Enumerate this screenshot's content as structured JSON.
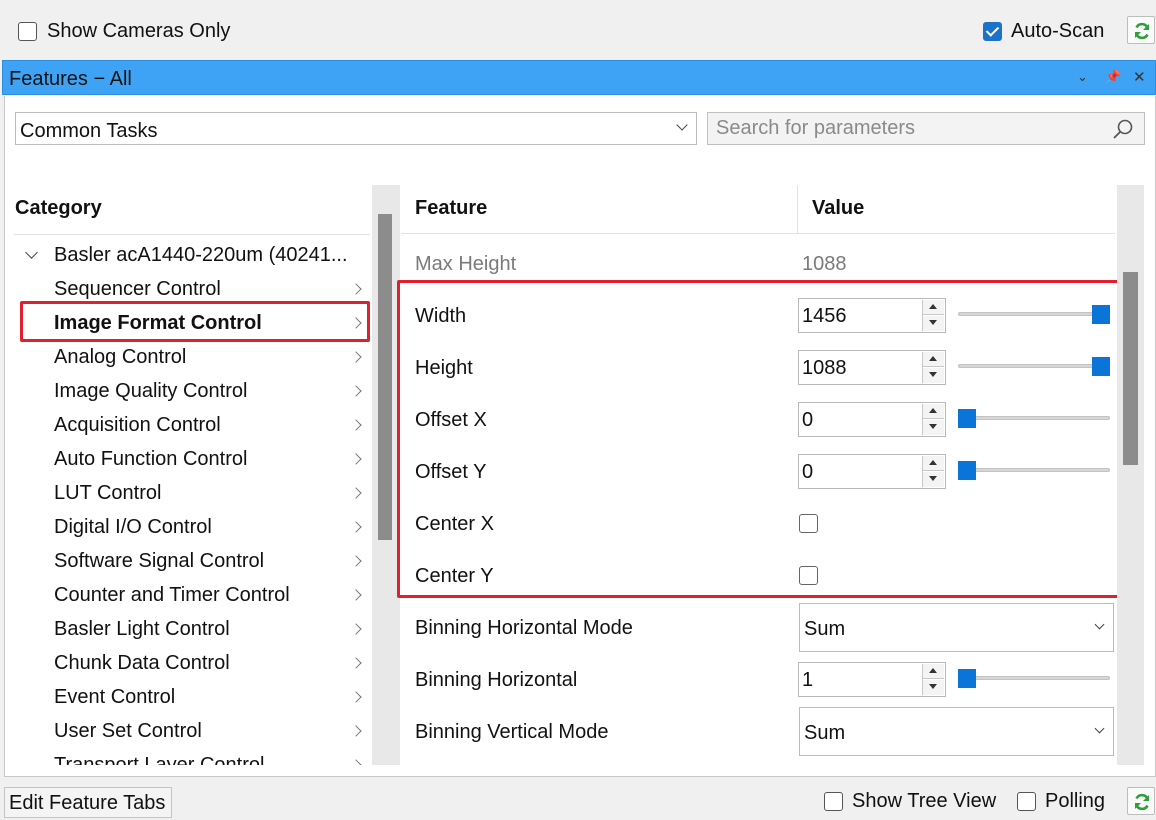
{
  "top_bar": {
    "show_cameras_only": {
      "label": "Show Cameras Only",
      "checked": false
    },
    "auto_scan": {
      "label": "Auto-Scan",
      "checked": true
    }
  },
  "panel": {
    "title": "Features − All",
    "title_icons": [
      "chevron-down-icon",
      "pin-icon",
      "close-icon"
    ]
  },
  "toolbar": {
    "view_select": "Common Tasks",
    "search_placeholder": "Search for parameters"
  },
  "category": {
    "header": "Category",
    "device": "Basler acA1440-220um (40241...",
    "items": [
      {
        "label": "Sequencer Control",
        "selected": false
      },
      {
        "label": "Image Format Control",
        "selected": true
      },
      {
        "label": "Analog Control",
        "selected": false
      },
      {
        "label": "Image Quality Control",
        "selected": false
      },
      {
        "label": "Acquisition Control",
        "selected": false
      },
      {
        "label": "Auto Function Control",
        "selected": false
      },
      {
        "label": "LUT Control",
        "selected": false
      },
      {
        "label": "Digital I/O Control",
        "selected": false
      },
      {
        "label": "Software Signal Control",
        "selected": false
      },
      {
        "label": "Counter and Timer Control",
        "selected": false
      },
      {
        "label": "Basler Light Control",
        "selected": false
      },
      {
        "label": "Chunk Data Control",
        "selected": false
      },
      {
        "label": "Event Control",
        "selected": false
      },
      {
        "label": "User Set Control",
        "selected": false
      },
      {
        "label": "Transport Layer Control",
        "selected": false
      }
    ]
  },
  "features": {
    "header_feature": "Feature",
    "header_value": "Value",
    "rows": [
      {
        "name": "Max Height",
        "type": "readonly",
        "value": "1088"
      },
      {
        "name": "Width",
        "type": "spin",
        "value": "1456",
        "slider_level": 1.0
      },
      {
        "name": "Height",
        "type": "spin",
        "value": "1088",
        "slider_level": 1.0
      },
      {
        "name": "Offset X",
        "type": "spin",
        "value": "0",
        "slider_level": 0.0
      },
      {
        "name": "Offset Y",
        "type": "spin",
        "value": "0",
        "slider_level": 0.0
      },
      {
        "name": "Center X",
        "type": "checkbox",
        "checked": false
      },
      {
        "name": "Center Y",
        "type": "checkbox",
        "checked": false
      },
      {
        "name": "Binning Horizontal Mode",
        "type": "combo",
        "value": "Sum"
      },
      {
        "name": "Binning Horizontal",
        "type": "spin",
        "value": "1",
        "slider_level": 0.0
      },
      {
        "name": "Binning Vertical Mode",
        "type": "combo",
        "value": "Sum"
      }
    ]
  },
  "bottom_bar": {
    "edit_tabs_label": "Edit Feature Tabs",
    "show_tree_view": {
      "label": "Show Tree View",
      "checked": false
    },
    "polling": {
      "label": "Polling",
      "checked": false
    }
  },
  "colors": {
    "title_bar": "#3fa3f5",
    "highlight_box": "#e0202e",
    "slider_thumb": "#0a74d8",
    "refresh_icon": "#2e9e3a"
  }
}
